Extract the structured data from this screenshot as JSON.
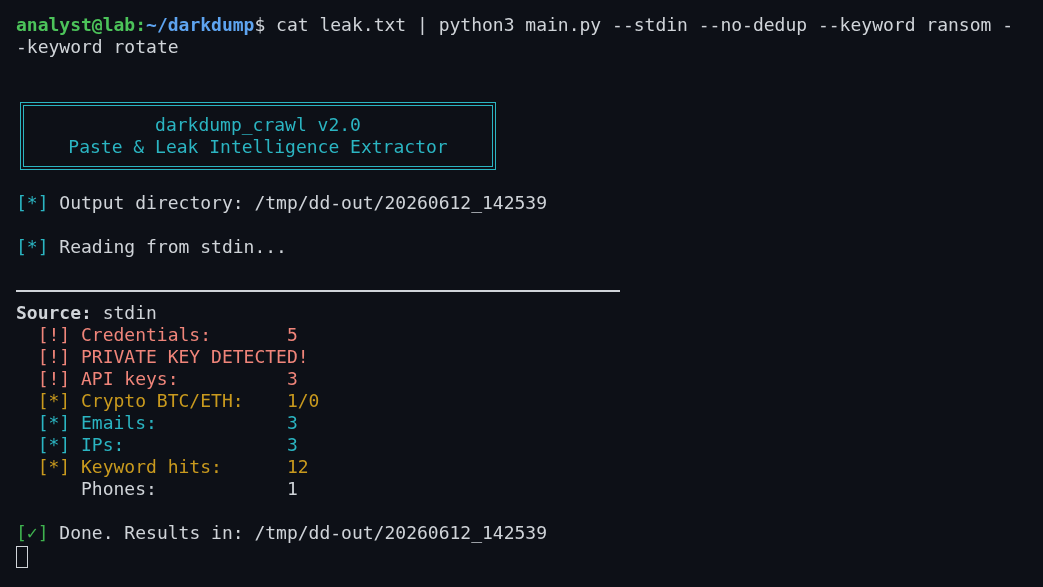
{
  "prompt": {
    "user": "analyst@lab",
    "separator": ":",
    "path": "~/darkdump",
    "symbol": "$",
    "command": "cat leak.txt | python3 main.py --stdin --no-dedup --keyword ransom --keyword rotate"
  },
  "banner": {
    "title": "darkdump_crawl v2.0",
    "subtitle": "Paste & Leak Intelligence Extractor"
  },
  "messages": [
    {
      "kind": "info",
      "marker": "[*]",
      "text": "Output directory: /tmp/dd-out/20260612_142539"
    },
    {
      "kind": "info",
      "marker": "[*]",
      "text": "Reading from stdin..."
    }
  ],
  "source": {
    "label": "Source:",
    "value": "stdin"
  },
  "findings": [
    {
      "kind": "alert",
      "marker": "[!]",
      "label": "Credentials:",
      "value": "5"
    },
    {
      "kind": "alert",
      "marker": "[!]",
      "label": "PRIVATE KEY DETECTED!"
    },
    {
      "kind": "alert",
      "marker": "[!]",
      "label": "API keys:",
      "value": "3"
    },
    {
      "kind": "warn",
      "marker": "[*]",
      "label": "Crypto BTC/ETH:",
      "value": "1/0"
    },
    {
      "kind": "info",
      "marker": "[*]",
      "label": "Emails:",
      "value": "3"
    },
    {
      "kind": "info",
      "marker": "[*]",
      "label": "IPs:",
      "value": "3"
    },
    {
      "kind": "warn",
      "marker": "[*]",
      "label": "Keyword hits:",
      "value": "12"
    },
    {
      "kind": "plain",
      "label": "Phones:",
      "value": "1"
    }
  ],
  "done": {
    "kind": "success",
    "marker": "[✓]",
    "text": "Done. Results in: /tmp/dd-out/20260612_142539"
  }
}
